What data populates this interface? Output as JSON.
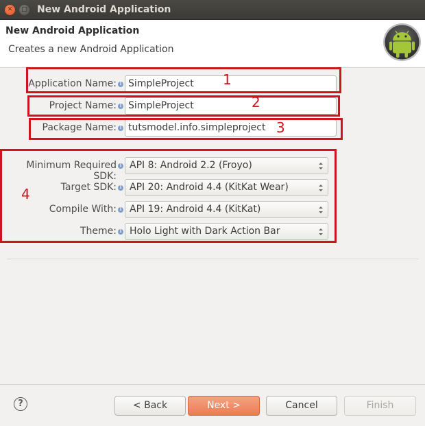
{
  "window": {
    "title": "New Android Application",
    "close_glyph": "✕",
    "max_glyph": "□"
  },
  "header": {
    "title": "New Android Application",
    "description": "Creates a new Android Application"
  },
  "form": {
    "application_name": {
      "label": "Application Name:",
      "value": "SimpleProject"
    },
    "project_name": {
      "label": "Project Name:",
      "value": "SimpleProject"
    },
    "package_name": {
      "label": "Package Name:",
      "value": "tutsmodel.info.simpleproject"
    },
    "min_sdk": {
      "label": "Minimum Required SDK:",
      "value": "API 8: Android 2.2 (Froyo)"
    },
    "target_sdk": {
      "label": "Target SDK:",
      "value": "API 20: Android 4.4 (KitKat Wear)"
    },
    "compile_with": {
      "label": "Compile With:",
      "value": "API 19: Android 4.4 (KitKat)"
    },
    "theme": {
      "label": "Theme:",
      "value": "Holo Light with Dark Action Bar"
    }
  },
  "annotations": {
    "n1": "1",
    "n2": "2",
    "n3": "3",
    "n4": "4",
    "color": "#d0141d"
  },
  "buttons": {
    "help": "?",
    "back": "< Back",
    "next": "Next >",
    "cancel": "Cancel",
    "finish": "Finish"
  },
  "colors": {
    "titlebar": "#3b3a36",
    "accent_next": "#ec7c53",
    "android_green": "#a4c639"
  },
  "icons": {
    "info": "info-icon",
    "logo": "android-logo-icon"
  }
}
